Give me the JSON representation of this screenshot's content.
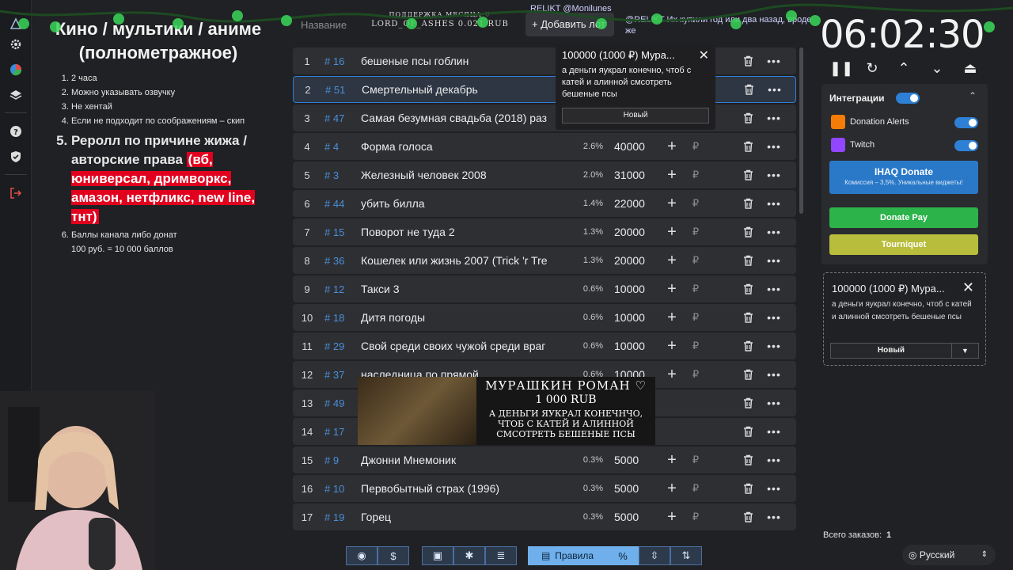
{
  "rules": {
    "title": "Кино / мультики / аниме (полнометражное)",
    "items": [
      "2 часа",
      "Можно указывать озвучку",
      "Не хентай",
      "Если не подходит по соображениям – скип"
    ],
    "big_item": {
      "text": "Реролл по причине жижа / авторские права",
      "red": "(вб, юниверсал, дримворкс, амазон, нетфликс, new line, тнт)"
    },
    "last_item": {
      "line1": "Баллы канала либо донат",
      "line2": "100 руб. = 10 000 баллов"
    }
  },
  "search": {
    "placeholder": "Название"
  },
  "add_button": "Добавить лот",
  "support": {
    "line1": "ПОДДЕРЖКА МЕСЯЦА ♡",
    "line2": "LORD_OF_ASHES 0.021 RUB"
  },
  "chat": {
    "line1": "RELIKT @Monilunes",
    "line2": "@RELIKT Их купили год или два назад, вроде же"
  },
  "lots": [
    {
      "n": "1",
      "id": "# 16",
      "name": "бешеные псы гоблин",
      "pct": "",
      "amount": ""
    },
    {
      "n": "2",
      "id": "# 51",
      "name": "Смертельный декабрь",
      "pct": "",
      "amount": ""
    },
    {
      "n": "3",
      "id": "# 47",
      "name": "Самая безумная свадьба (2018) раз",
      "pct": "",
      "amount": ""
    },
    {
      "n": "4",
      "id": "# 4",
      "name": "Форма голоса",
      "pct": "2.6%",
      "amount": "40000"
    },
    {
      "n": "5",
      "id": "# 3",
      "name": "Железный человек 2008",
      "pct": "2.0%",
      "amount": "31000"
    },
    {
      "n": "6",
      "id": "# 44",
      "name": "убить билла",
      "pct": "1.4%",
      "amount": "22000"
    },
    {
      "n": "7",
      "id": "# 15",
      "name": "Поворот не туда 2",
      "pct": "1.3%",
      "amount": "20000"
    },
    {
      "n": "8",
      "id": "# 36",
      "name": "Кошелек или жизнь 2007 (Trick 'r Tre",
      "pct": "1.3%",
      "amount": "20000"
    },
    {
      "n": "9",
      "id": "# 12",
      "name": "Такси 3",
      "pct": "0.6%",
      "amount": "10000"
    },
    {
      "n": "10",
      "id": "# 18",
      "name": "Дитя погоды",
      "pct": "0.6%",
      "amount": "10000"
    },
    {
      "n": "11",
      "id": "# 29",
      "name": "Свой среди своих чужой среди враг",
      "pct": "0.6%",
      "amount": "10000"
    },
    {
      "n": "12",
      "id": "# 37",
      "name": "наследница по прямой",
      "pct": "0.6%",
      "amount": "10000"
    },
    {
      "n": "13",
      "id": "# 49",
      "name": "",
      "pct": "",
      "amount": ""
    },
    {
      "n": "14",
      "id": "# 17",
      "name": "",
      "pct": "",
      "amount": ""
    },
    {
      "n": "15",
      "id": "# 9",
      "name": "Джонни Мнемоник",
      "pct": "0.3%",
      "amount": "5000"
    },
    {
      "n": "16",
      "id": "# 10",
      "name": "Первобытный страх (1996)",
      "pct": "0.3%",
      "amount": "5000"
    },
    {
      "n": "17",
      "id": "# 19",
      "name": "Горец",
      "pct": "0.3%",
      "amount": "5000"
    }
  ],
  "currency_symbol": "₽",
  "popup": {
    "title": "100000 (1000 ₽) Мура...",
    "message": "а деньги яукрал конечно, чтоб с катей и алинной смсотреть бешеные псы",
    "select": "Новый"
  },
  "overlay": {
    "name": "МУРАШКИН РОМАН ♡",
    "amount": "1 000 RUB",
    "message": "А ДЕНЬГИ ЯУКРАЛ КОНЕЧНЧО, ЧТОБ С КАТЕЙ И АЛИННОЙ СМСОТРЕТЬ БЕШЕНЫЕ ПСЫ"
  },
  "timer": "06:02:30",
  "integrations": {
    "header": "Интеграции",
    "items": [
      {
        "label": "Donation Alerts",
        "enabled": true
      },
      {
        "label": "Twitch",
        "enabled": true
      }
    ],
    "ihaq": {
      "title": "IHAQ Donate",
      "subtitle": "Комиссия – 3,5%. Уникальные виджеты!"
    },
    "donatepay": "Donate Pay",
    "tourniquet": "Tourniquet"
  },
  "card": {
    "title": "100000 (1000 ₽) Мура...",
    "message": "а деньги яукрал конечно, чтоб с катей и алинной смсотреть бешеные псы",
    "status": "Новый"
  },
  "total": {
    "label": "Всего заказов:",
    "value": "1"
  },
  "language": "Русский",
  "toolbar": {
    "rules_label": "Правила",
    "percent": "%"
  },
  "colors": {
    "accent": "#2d80d6",
    "red_highlight": "#e1001e",
    "donatepay": "#2cb34a",
    "tourniquet": "#b8bd3c"
  }
}
